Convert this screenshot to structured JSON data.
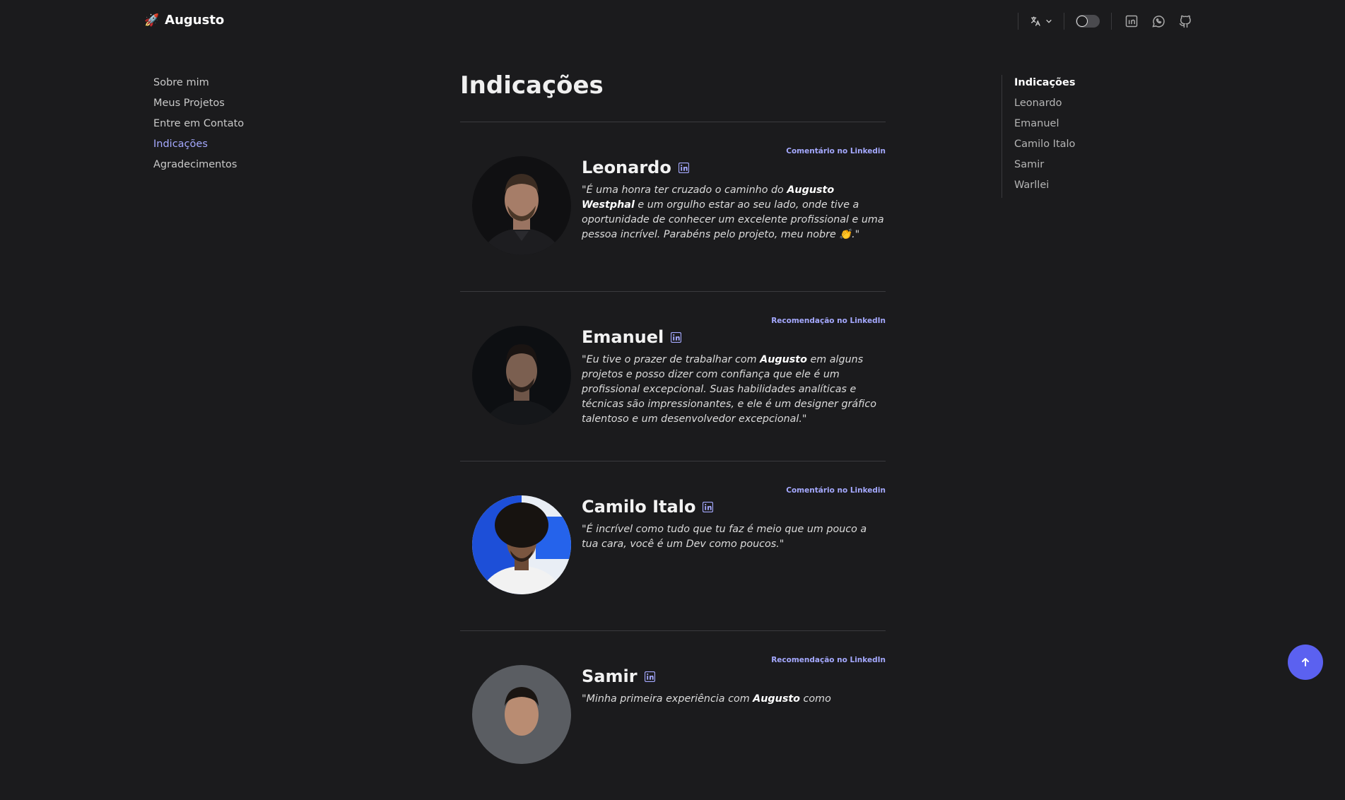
{
  "navbar": {
    "brand": "Augusto",
    "brand_icon": "rocket-icon",
    "language_icon": "translate-icon",
    "theme_icon": "dark-mode-toggle",
    "social_icons": [
      "linkedin-icon",
      "whatsapp-icon",
      "github-icon"
    ]
  },
  "sidebar": {
    "items": [
      {
        "label": "Sobre mim"
      },
      {
        "label": "Meus Projetos"
      },
      {
        "label": "Entre em Contato"
      },
      {
        "label": "Indicações",
        "active": true
      },
      {
        "label": "Agradecimentos"
      }
    ]
  },
  "main": {
    "title": "Indicações",
    "cards": [
      {
        "name": "Leonardo",
        "source": "Comentário no Linkedin",
        "quote_parts": [
          {
            "t": "\"É uma honra ter cruzado o caminho do "
          },
          {
            "t": "Augusto Westphal",
            "b": true
          },
          {
            "t": " e um orgulho estar ao seu lado, onde tive a oportunidade de conhecer um excelente profissional e uma pessoa incrível. Parabéns pelo projeto, meu nobre 👏.\""
          }
        ]
      },
      {
        "name": "Emanuel",
        "source": "Recomendação no LinkedIn",
        "quote_parts": [
          {
            "t": "\"Eu tive o prazer de trabalhar com "
          },
          {
            "t": "Augusto",
            "b": true
          },
          {
            "t": " em alguns projetos e posso dizer com confiança que ele é um profissional excepcional. Suas habilidades analíticas e técnicas são impressionantes, e ele é um designer gráfico talentoso e um desenvolvedor excepcional.\""
          }
        ]
      },
      {
        "name": "Camilo Italo",
        "source": "Comentário no Linkedin",
        "quote_parts": [
          {
            "t": "\"É incrível como tudo que tu faz é meio que um pouco a tua cara, você é um Dev como poucos.\""
          }
        ]
      },
      {
        "name": "Samir",
        "source": "Recomendação no LinkedIn",
        "quote_parts": [
          {
            "t": "\"Minha primeira experiência com "
          },
          {
            "t": "Augusto",
            "b": true
          },
          {
            "t": " como"
          }
        ]
      }
    ]
  },
  "toc": {
    "items": [
      {
        "label": "Indicações",
        "active": true
      },
      {
        "label": "Leonardo"
      },
      {
        "label": "Emanuel"
      },
      {
        "label": "Camilo Italo"
      },
      {
        "label": "Samir"
      },
      {
        "label": "Warllei"
      }
    ]
  },
  "colors": {
    "background": "#1b1b1d",
    "accent": "#a5a9ff",
    "button": "#5b61f0"
  },
  "scroll_top_icon": "arrow-up-icon"
}
